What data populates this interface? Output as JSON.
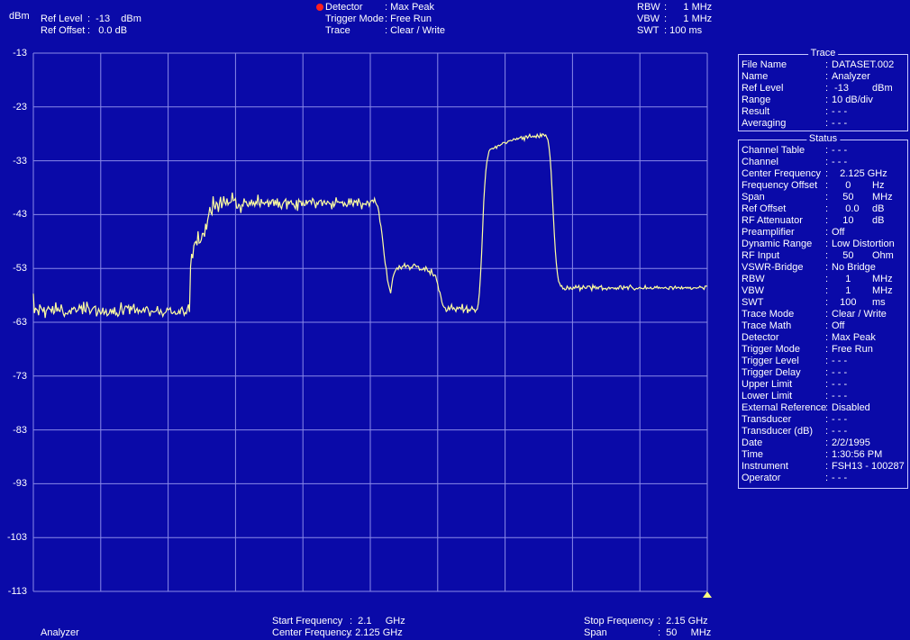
{
  "header": {
    "unit": "dBm",
    "ref_level_label": "Ref Level",
    "ref_level_value": ":  -13    dBm",
    "ref_offset_label": "Ref Offset",
    "ref_offset_value": ":   0.0 dB",
    "detector_label": "Detector",
    "detector_value": ": Max Peak",
    "trigger_mode_label": "Trigger Mode",
    "trigger_mode_value": ": Free Run",
    "trace_label": "Trace",
    "trace_value": ": Clear / Write",
    "rbw_label": "RBW",
    "rbw_value": ":      1 MHz",
    "vbw_label": "VBW",
    "vbw_value": ":      1 MHz",
    "swt_label": "SWT",
    "swt_value": ": 100 ms"
  },
  "footer": {
    "mode": "Analyzer",
    "start_freq_label": "Start Frequency",
    "start_freq_value": ":  2.1     GHz",
    "center_freq_label": "Center Frequency",
    "center_freq_value": ": 2.125 GHz",
    "stop_freq_label": "Stop Frequency",
    "stop_freq_value": ":  2.15 GHz",
    "span_label": "Span",
    "span_value": ":  50     MHz"
  },
  "trace_panel": {
    "title": "Trace",
    "rows": [
      {
        "k": "File Name",
        "v": "DATASET.002",
        "u": ""
      },
      {
        "k": "Name",
        "v": "Analyzer",
        "u": ""
      },
      {
        "k": "Ref Level",
        "v": " -13",
        "u": "dBm"
      },
      {
        "k": "Range",
        "v": "10 dB/div",
        "u": ""
      },
      {
        "k": "Result",
        "v": "- - -",
        "u": ""
      },
      {
        "k": "Averaging",
        "v": "- - -",
        "u": ""
      }
    ]
  },
  "status_panel": {
    "title": "Status",
    "rows": [
      {
        "k": "Channel Table",
        "v": "- - -",
        "u": ""
      },
      {
        "k": "Channel",
        "v": "- - -",
        "u": ""
      },
      {
        "k": "Center Frequency",
        "v": "   2.125 GHz",
        "u": ""
      },
      {
        "k": "Frequency Offset",
        "v": "     0",
        "u": "Hz"
      },
      {
        "k": "Span",
        "v": "    50",
        "u": "MHz"
      },
      {
        "k": "Ref Offset",
        "v": "     0.0",
        "u": "dB"
      },
      {
        "k": "RF Attenuator",
        "v": "    10",
        "u": "dB"
      },
      {
        "k": "Preamplifier",
        "v": "Off",
        "u": ""
      },
      {
        "k": "Dynamic Range",
        "v": "Low Distortion",
        "u": ""
      },
      {
        "k": "RF Input",
        "v": "    50",
        "u": "Ohm"
      },
      {
        "k": "VSWR-Bridge",
        "v": "No Bridge",
        "u": ""
      },
      {
        "k": "RBW",
        "v": "     1",
        "u": "MHz"
      },
      {
        "k": "VBW",
        "v": "     1",
        "u": "MHz"
      },
      {
        "k": "SWT",
        "v": "   100",
        "u": "ms"
      },
      {
        "k": "Trace Mode",
        "v": "Clear / Write",
        "u": ""
      },
      {
        "k": "Trace Math",
        "v": "Off",
        "u": ""
      },
      {
        "k": "Detector",
        "v": "Max Peak",
        "u": ""
      },
      {
        "k": "Trigger Mode",
        "v": "Free Run",
        "u": ""
      },
      {
        "k": "Trigger Level",
        "v": "- - -",
        "u": ""
      },
      {
        "k": "Trigger Delay",
        "v": "- - -",
        "u": ""
      },
      {
        "k": "Upper Limit",
        "v": "- - -",
        "u": ""
      },
      {
        "k": "Lower Limit",
        "v": "- - -",
        "u": ""
      },
      {
        "k": "External Reference",
        "v": "Disabled",
        "u": ""
      },
      {
        "k": "Transducer",
        "v": "- - -",
        "u": ""
      },
      {
        "k": "Transducer (dB)",
        "v": "- - -",
        "u": ""
      },
      {
        "k": "Date",
        "v": "2/2/1995",
        "u": ""
      },
      {
        "k": "Time",
        "v": "1:30:56 PM",
        "u": ""
      },
      {
        "k": "Instrument",
        "v": "FSH13 - 100287",
        "u": ""
      },
      {
        "k": "Operator",
        "v": "- - -",
        "u": ""
      }
    ]
  },
  "colors": {
    "background": "#0a0aa8",
    "grid": "#8a8ae8",
    "trace": "#ffffa0",
    "detector_dot": "#ff2020"
  },
  "chart_data": {
    "type": "line",
    "title": "",
    "xlabel": "",
    "ylabel": "dBm",
    "xlim": [
      2.1,
      2.15
    ],
    "ylim": [
      -113,
      -13
    ],
    "yticks": [
      -13,
      -23,
      -33,
      -43,
      -53,
      -63,
      -73,
      -83,
      -93,
      -103,
      -113
    ],
    "grid": true,
    "series": [
      {
        "x_start": 2.1,
        "x_end": 2.15,
        "values": [
          -57.7,
          -61.3,
          -60.4,
          -60.6,
          -60.8,
          -61.7,
          -59.7,
          -60.2,
          -60.6,
          -61.0,
          -60.2,
          -62.2,
          -60.9,
          -60.6,
          -60.1,
          -60.5,
          -60.6,
          -61.1,
          -60.0,
          -61.4,
          -61.1,
          -59.3,
          -61.0,
          -60.4,
          -60.9,
          -61.0,
          -59.7,
          -60.5,
          -61.4,
          -61.9,
          -61.3,
          -61.4,
          -61.5,
          -61.0,
          -60.8,
          -61.5,
          -60.4,
          -60.6,
          -60.2,
          -60.4,
          -61.1,
          -60.9,
          -60.7,
          -59.8,
          -60.4,
          -60.0,
          -61.5,
          -59.2,
          -60.9,
          -61.1,
          -59.2,
          -60.1,
          -60.4,
          -61.4,
          -61.0,
          -60.6,
          -60.3,
          -60.1,
          -60.0,
          -61.9,
          -61.4,
          -60.5,
          -61.0,
          -61.5,
          -61.2,
          -60.3,
          -61.5,
          -61.2,
          -60.7,
          -61.8,
          -61.6,
          -61.3,
          -60.5,
          -61.3,
          -60.7,
          -61.5,
          -60.2,
          -61.6,
          -61.3,
          -61.9,
          -61.6,
          -60.7,
          -59.3,
          -60.8,
          -61.6,
          -60.6,
          -60.0,
          -60.0,
          -60.3,
          -59.9,
          -61.5,
          -60.0,
          -60.7,
          -60.2,
          -59.6,
          -61.3,
          -60.8,
          -60.4,
          -61.3,
          -60.7,
          -60.9,
          -61.2,
          -60.8,
          -60.4,
          -61.2,
          -60.3,
          -60.1,
          -60.4,
          -61.1,
          -61.9,
          -61.0,
          -60.9,
          -61.1,
          -61.1,
          -61.0,
          -60.9,
          -60.0,
          -61.2,
          -61.5,
          -60.7,
          -61.2,
          -61.9,
          -61.4,
          -61.3,
          -61.1,
          -60.4,
          -60.7,
          -60.6,
          -60.3,
          -61.3,
          -61.4,
          -61.2,
          -61.0,
          -61.5,
          -61.5,
          -61.4,
          -60.8,
          -61.5,
          -60.5,
          -60.2,
          -60.9,
          -61.7,
          -61.2,
          -61.4,
          -60.4,
          -59.7,
          -61.1,
          -52.7,
          -50.3,
          -51.1,
          -48.8,
          -48.2,
          -48.0,
          -48.7,
          -46.1,
          -48.3,
          -48.2,
          -47.7,
          -46.5,
          -46.5,
          -47.1,
          -44.7,
          -45.8,
          -44.0,
          -43.0,
          -41.6,
          -42.6,
          -43.0,
          -39.6,
          -41.4,
          -42.0,
          -40.7,
          -41.0,
          -42.5,
          -40.9,
          -39.7,
          -41.8,
          -40.9,
          -39.6,
          -40.8,
          -41.2,
          -40.0,
          -41.2,
          -40.8,
          -40.8,
          -40.6,
          -38.9,
          -40.4,
          -40.3,
          -40.0,
          -41.8,
          -41.8,
          -41.1,
          -41.3,
          -42.7,
          -41.2,
          -41.4,
          -40.0,
          -40.7,
          -40.6,
          -41.3,
          -41.5,
          -40.7,
          -41.2,
          -40.2,
          -41.2,
          -40.7,
          -41.4,
          -40.6,
          -41.0,
          -39.3,
          -41.0,
          -41.5,
          -40.1,
          -40.9,
          -40.8,
          -41.1,
          -40.7,
          -40.8,
          -40.3,
          -41.6,
          -40.6,
          -41.0,
          -40.3,
          -40.2,
          -41.4,
          -40.3,
          -41.3,
          -40.0,
          -41.7,
          -40.6,
          -41.5,
          -41.9,
          -41.1,
          -40.7,
          -40.4,
          -40.1,
          -42.0,
          -40.4,
          -41.0,
          -40.6,
          -40.4,
          -41.1,
          -41.0,
          -41.5,
          -41.9,
          -40.3,
          -42.3,
          -40.2,
          -40.6,
          -40.5,
          -41.4,
          -40.6,
          -41.3,
          -41.3,
          -40.3,
          -41.0,
          -40.6,
          -40.4,
          -40.4,
          -41.0,
          -40.0,
          -40.3,
          -41.0,
          -41.8,
          -40.8,
          -41.1,
          -40.5,
          -40.4,
          -40.3,
          -41.4,
          -40.7,
          -40.4,
          -41.0,
          -41.1,
          -40.5,
          -40.7,
          -41.0,
          -41.0,
          -42.0,
          -40.5,
          -41.5,
          -41.1,
          -39.8,
          -40.7,
          -40.6,
          -40.8,
          -40.7,
          -40.8,
          -40.6,
          -41.5,
          -40.8,
          -41.2,
          -41.5,
          -41.1,
          -40.0,
          -41.2,
          -40.0,
          -40.9,
          -41.4,
          -40.4,
          -40.7,
          -40.4,
          -41.4,
          -40.0,
          -40.6,
          -41.0,
          -42.0,
          -40.9,
          -41.1,
          -41.0,
          -41.2,
          -40.5,
          -40.7,
          -41.4,
          -40.7,
          -40.4,
          -40.3,
          -40.7,
          -40.0,
          -40.8,
          -41.2,
          -41.5,
          -42.5,
          -44.3,
          -45.2,
          -46.8,
          -48.5,
          -50.5,
          -52.2,
          -53.1,
          -55.1,
          -56.0,
          -56.8,
          -57.6,
          -56.2,
          -54.8,
          -54.1,
          -53.6,
          -53.2,
          -52.9,
          -53.2,
          -52.5,
          -52.8,
          -53.1,
          -52.6,
          -52.6,
          -52.1,
          -52.8,
          -52.5,
          -52.4,
          -52.6,
          -53.2,
          -52.8,
          -52.9,
          -52.4,
          -52.2,
          -52.4,
          -52.7,
          -52.6,
          -52.6,
          -53.3,
          -53.2,
          -53.3,
          -53.2,
          -52.9,
          -53.4,
          -52.7,
          -53.1,
          -53.6,
          -53.5,
          -54.1,
          -53.1,
          -54.0,
          -54.4,
          -54.2,
          -54.3,
          -55.2,
          -55.9,
          -57.1,
          -57.4,
          -58.3,
          -59.3,
          -59.9,
          -60.2,
          -60.3,
          -61.0,
          -60.8,
          -60.1,
          -60.7,
          -60.3,
          -59.7,
          -60.6,
          -60.3,
          -60.6,
          -61.0,
          -60.2,
          -60.5,
          -60.2,
          -60.3,
          -60.6,
          -59.6,
          -61.1,
          -60.7,
          -60.5,
          -60.0,
          -61.3,
          -60.6,
          -60.9,
          -60.6,
          -60.1,
          -60.6,
          -60.6,
          -61.1,
          -60.7,
          -60.6,
          -59.5,
          -57.5,
          -54.3,
          -50.4,
          -45.6,
          -40.6,
          -37.6,
          -34.9,
          -33.2,
          -32.2,
          -31.2,
          -30.9,
          -30.8,
          -30.7,
          -30.8,
          -30.6,
          -30.3,
          -30.7,
          -30.2,
          -30.1,
          -30.2,
          -30.0,
          -29.9,
          -29.6,
          -29.6,
          -29.6,
          -29.8,
          -29.6,
          -29.3,
          -29.3,
          -29.2,
          -29.3,
          -29.2,
          -28.9,
          -29.0,
          -29.1,
          -28.8,
          -29.0,
          -28.8,
          -28.7,
          -28.5,
          -29.0,
          -28.6,
          -29.2,
          -28.4,
          -28.4,
          -28.8,
          -28.5,
          -28.1,
          -28.6,
          -28.6,
          -28.4,
          -28.6,
          -28.4,
          -28.7,
          -28.1,
          -28.5,
          -28.7,
          -28.0,
          -28.5,
          -28.0,
          -28.1,
          -28.4,
          -28.2,
          -28.7,
          -29.1,
          -30.4,
          -32.3,
          -35.1,
          -38.7,
          -42.6,
          -46.5,
          -49.8,
          -52.3,
          -54.1,
          -55.4,
          -55.8,
          -56.3,
          -56.2,
          -56.8,
          -56.7,
          -57.0,
          -56.9,
          -56.3,
          -56.6,
          -56.9,
          -56.5,
          -56.8,
          -56.9,
          -56.5,
          -56.7,
          -56.2,
          -56.6,
          -56.5,
          -56.2,
          -57.1,
          -56.6,
          -56.8,
          -56.2,
          -56.5,
          -56.7,
          -56.7,
          -56.3,
          -56.3,
          -56.3,
          -56.6,
          -57.1,
          -56.1,
          -56.6,
          -56.3,
          -56.8,
          -56.5,
          -56.8,
          -56.4,
          -56.4,
          -56.2,
          -57.0,
          -56.7,
          -56.8,
          -56.7,
          -57.0,
          -56.7,
          -56.5,
          -56.8,
          -56.6,
          -56.6,
          -56.6,
          -56.8,
          -56.6,
          -56.9,
          -56.6,
          -56.8,
          -56.3,
          -56.2,
          -56.7,
          -56.9,
          -56.3,
          -56.6,
          -56.5,
          -56.4,
          -56.9,
          -56.4,
          -56.1,
          -56.4,
          -56.6,
          -56.8,
          -57.0,
          -56.8,
          -56.7,
          -56.8,
          -56.6,
          -56.5,
          -56.7,
          -56.7,
          -56.8,
          -56.7,
          -56.2,
          -56.8,
          -56.6,
          -56.7,
          -56.7,
          -56.5,
          -56.8,
          -56.8,
          -56.7,
          -56.4,
          -56.6,
          -56.3,
          -56.7,
          -56.5,
          -56.7,
          -56.6,
          -56.6,
          -56.7,
          -56.6,
          -56.5,
          -56.7,
          -56.8,
          -56.9,
          -56.4,
          -56.4,
          -56.5,
          -56.9,
          -56.6,
          -56.3,
          -56.7,
          -56.6,
          -56.5,
          -56.6,
          -56.8,
          -56.4,
          -56.8,
          -56.6,
          -56.6,
          -56.5,
          -56.7,
          -56.5,
          -56.7,
          -56.5,
          -56.9,
          -56.8,
          -56.6,
          -56.6,
          -56.6,
          -56.7,
          -56.6,
          -56.6,
          -56.3,
          -56.5,
          -56.5,
          -56.7,
          -56.9,
          -56.3,
          -56.3,
          -56.3
        ]
      }
    ]
  }
}
